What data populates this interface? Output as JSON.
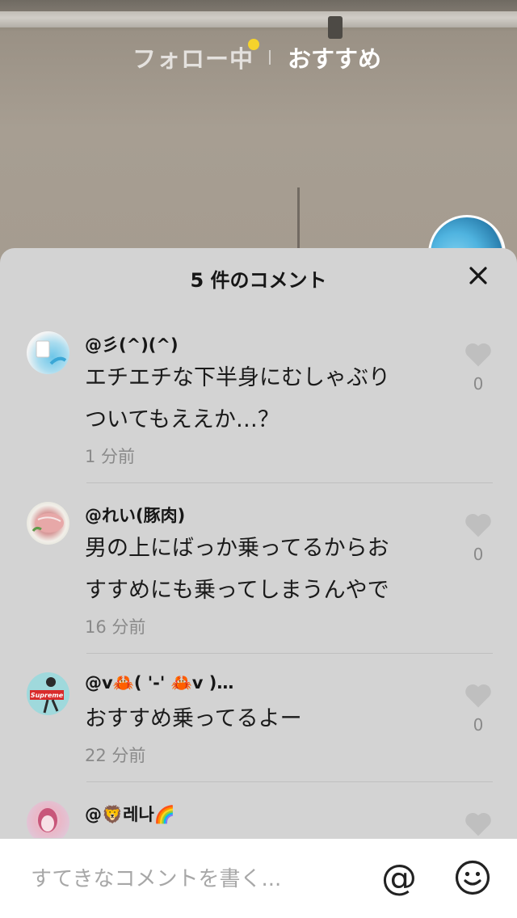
{
  "feed_tabs": {
    "following": "フォロー中",
    "recommended": "おすすめ"
  },
  "colors": {
    "notification_dot": "#f6d32b",
    "sheet_background": "#d3d3d3"
  },
  "comments_sheet": {
    "title": "5 件のコメント",
    "comments": [
      {
        "username": "@彡(^)(^)",
        "text_line1": "エチエチな下半身にむしゃぶり",
        "text_line2": "ついてもええか…？",
        "time": "1 分前",
        "likes": "0"
      },
      {
        "username": "@れい(豚肉)",
        "text_line1": "男の上にばっか乗ってるからお",
        "text_line2": "すすめにも乗ってしまうんやで",
        "time": "16 分前",
        "likes": "0"
      },
      {
        "username": "@v🦀( '-' 🦀v )…",
        "text_line1": "おすすめ乗ってるよー",
        "time": "22 分前",
        "likes": "0"
      },
      {
        "username": "@🦁레나🌈"
      }
    ]
  },
  "input": {
    "placeholder": "すてきなコメントを書く...",
    "mention_symbol": "@"
  },
  "icons": [
    "close-icon",
    "heart-icon",
    "at-icon",
    "emoji-icon"
  ]
}
